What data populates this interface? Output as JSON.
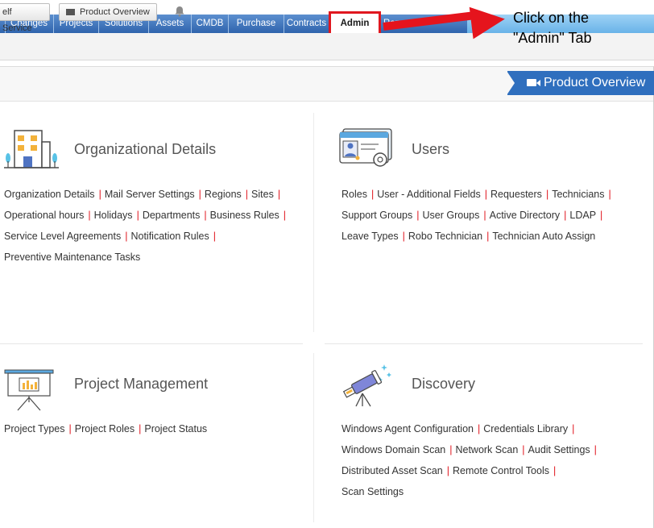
{
  "nav": {
    "tabs": [
      "Changes",
      "Projects",
      "Solutions",
      "Assets",
      "CMDB",
      "Purchase",
      "Contracts",
      "Admin",
      "Reports"
    ],
    "active": "Admin"
  },
  "toolbar": {
    "self_service": "elf Service",
    "product_overview": "Product Overview"
  },
  "banner": {
    "product_overview": "Product Overview"
  },
  "callout": {
    "line1": "Click on the",
    "line2": "\"Admin\" Tab"
  },
  "sections": {
    "org": {
      "title": "Organizational Details",
      "rows": [
        [
          "Organization Details",
          "Mail Server Settings",
          "Regions",
          "Sites"
        ],
        [
          "Operational hours",
          "Holidays",
          "Departments",
          "Business Rules"
        ],
        [
          "Service Level Agreements",
          "Notification Rules"
        ],
        [
          "Preventive Maintenance Tasks"
        ]
      ]
    },
    "users": {
      "title": "Users",
      "rows": [
        [
          "Roles",
          "User - Additional Fields",
          "Requesters",
          "Technicians"
        ],
        [
          "Support Groups",
          "User Groups",
          "Active Directory",
          "LDAP"
        ],
        [
          "Leave Types",
          "Robo Technician",
          "Technician Auto Assign"
        ]
      ]
    },
    "pm": {
      "title": "Project Management",
      "rows": [
        [
          "Project Types",
          "Project Roles",
          "Project Status"
        ]
      ]
    },
    "discovery": {
      "title": "Discovery",
      "rows": [
        [
          "Windows Agent Configuration",
          "Credentials Library"
        ],
        [
          "Windows Domain Scan",
          "Network Scan",
          "Audit Settings"
        ],
        [
          "Distributed Asset Scan",
          "Remote Control Tools"
        ],
        [
          "Scan Settings"
        ]
      ]
    }
  }
}
